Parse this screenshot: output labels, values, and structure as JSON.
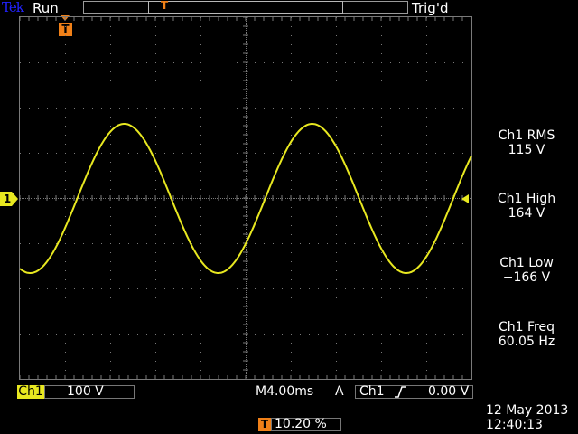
{
  "status_bar": {
    "brand": "Tek",
    "acquisition_state": "Run",
    "trigger_state": "Trig'd"
  },
  "markers": {
    "trigger_position": "T",
    "channel_ground": "1"
  },
  "colors": {
    "ch1_trace": "#e8e820",
    "trigger_marker": "#f08018",
    "grid": "#7a7a7a",
    "brand": "#2222ff"
  },
  "measurements": [
    {
      "label": "Ch1 RMS",
      "value": "115 V"
    },
    {
      "label": "Ch1 High",
      "value": "164 V"
    },
    {
      "label": "Ch1 Low",
      "value": "−166 V"
    },
    {
      "label": "Ch1 Freq",
      "value": "60.05 Hz"
    }
  ],
  "channel": {
    "name": "Ch1",
    "scale": "100 V"
  },
  "horizontal": {
    "timebase": "M4.00ms"
  },
  "trigger": {
    "mode": "A",
    "source": "Ch1",
    "slope_icon": "rising-edge-icon",
    "level": "0.00 V",
    "position_label": "T",
    "position_offset": "10.20 %"
  },
  "datetime": {
    "date": "12 May 2013",
    "time": "12:40:13"
  },
  "waveform": {
    "volts_per_div": 100,
    "seconds_per_div": 0.004,
    "frequency_hz": 60.05,
    "high_v": 164,
    "low_v": -166,
    "first_rising_zero_div": 1.27
  }
}
